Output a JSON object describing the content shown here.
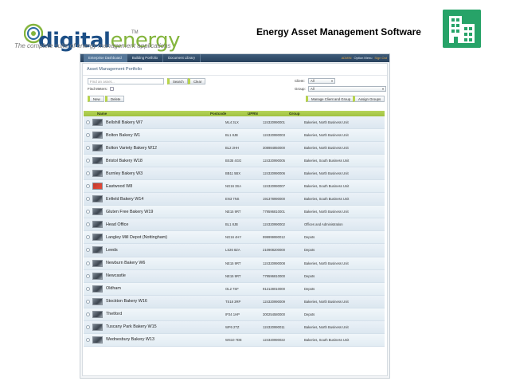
{
  "brand": {
    "name_part1": "digital",
    "name_part2": "energy",
    "trademark": "TM",
    "tagline": "The complete suite of energy management applications"
  },
  "header": {
    "title": "Energy Asset Management Software"
  },
  "icons": {
    "building": "building-icon",
    "logo_swirl": "swirl-logo-icon"
  },
  "colors": {
    "accent_green": "#9fc13f",
    "nav_blue": "#2d4a68",
    "brand_blue": "#2a6aa3",
    "icon_green": "#27a368"
  },
  "nav": {
    "tabs": [
      "Enterprise Dashboard",
      "Building Portfolio",
      "Document Library"
    ],
    "right": [
      "ADMIN",
      "Option Menu",
      "Sign Out"
    ]
  },
  "portfolio": {
    "title": "Asset Management Portfolio",
    "search_placeholder": "Find an asset...",
    "search_label": "Search",
    "clear_label": "Clear",
    "find_meters_label": "Find Meters:",
    "client_label": "Client:",
    "client_value": "All",
    "group_label": "Group:",
    "group_value": "All",
    "new_label": "New",
    "delete_label": "Delete",
    "manage_label": "Manage Client and Group",
    "assign_label": "Assign Groups"
  },
  "table": {
    "headers": {
      "name": "Name",
      "postcode": "Postcode",
      "uprn": "UPRN",
      "group": "Group"
    },
    "rows": [
      {
        "name": "Bellshill Bakery W7",
        "postcode": "ML4 3LX",
        "uprn": "124320990001",
        "group": "Bakeries, North Business Unit"
      },
      {
        "name": "Bolton Bakery W1",
        "postcode": "BL1 8JB",
        "uprn": "124320990003",
        "group": "Bakeries, North Business Unit"
      },
      {
        "name": "Bolton Variety Bakery W12",
        "postcode": "BL2 2HH",
        "uprn": "308984850000",
        "group": "Bakeries, North Business Unit"
      },
      {
        "name": "Bristol Bakery W18",
        "postcode": "BS35 4GG",
        "uprn": "124320990005",
        "group": "Bakeries, South Business Unit"
      },
      {
        "name": "Burnley Bakery W3",
        "postcode": "BB11 5BX",
        "uprn": "124320990006",
        "group": "Bakeries, North Business Unit"
      },
      {
        "name": "Eastwood W8",
        "postcode": "NG16 3SA",
        "uprn": "124320990007",
        "group": "Bakeries, South Business Unit"
      },
      {
        "name": "Enfield Bakery W14",
        "postcode": "EN3 7NS",
        "uprn": "191378990000",
        "group": "Bakeries, South Business Unit"
      },
      {
        "name": "Gluten Free Bakery W19",
        "postcode": "NE15 9RT",
        "uprn": "779596810001",
        "group": "Bakeries, North Business Unit"
      },
      {
        "name": "Head Office",
        "postcode": "BL1 8JB",
        "uprn": "124320990002",
        "group": "Offices and Administration"
      },
      {
        "name": "Langley Mill Depot (Nottingham)",
        "postcode": "NG16 4HY",
        "uprn": "999999990012",
        "group": "Depots"
      },
      {
        "name": "Leeds",
        "postcode": "LS26 8ZA",
        "uprn": "210908200000",
        "group": "Depots"
      },
      {
        "name": "Newburn Bakery W6",
        "postcode": "NE15 9RT",
        "uprn": "124320990008",
        "group": "Bakeries, North Business Unit"
      },
      {
        "name": "Newcastle",
        "postcode": "NE15 9RT",
        "uprn": "779596810000",
        "group": "Depots"
      },
      {
        "name": "Oldham",
        "postcode": "OL2 7SF",
        "uprn": "912128010000",
        "group": "Depots"
      },
      {
        "name": "Stockton Bakery W16",
        "postcode": "TS18 3RP",
        "uprn": "124320990009",
        "group": "Bakeries, North Business Unit"
      },
      {
        "name": "Thetford",
        "postcode": "IP24 1HP",
        "uprn": "300254580000",
        "group": "Depots"
      },
      {
        "name": "Tuscany Park Bakery W15",
        "postcode": "WF6 2TZ",
        "uprn": "124320990011",
        "group": "Bakeries, North Business Unit"
      },
      {
        "name": "Wednesbury Bakery W13",
        "postcode": "WS10 7DE",
        "uprn": "124320990022",
        "group": "Bakeries, South Business Unit"
      }
    ]
  }
}
